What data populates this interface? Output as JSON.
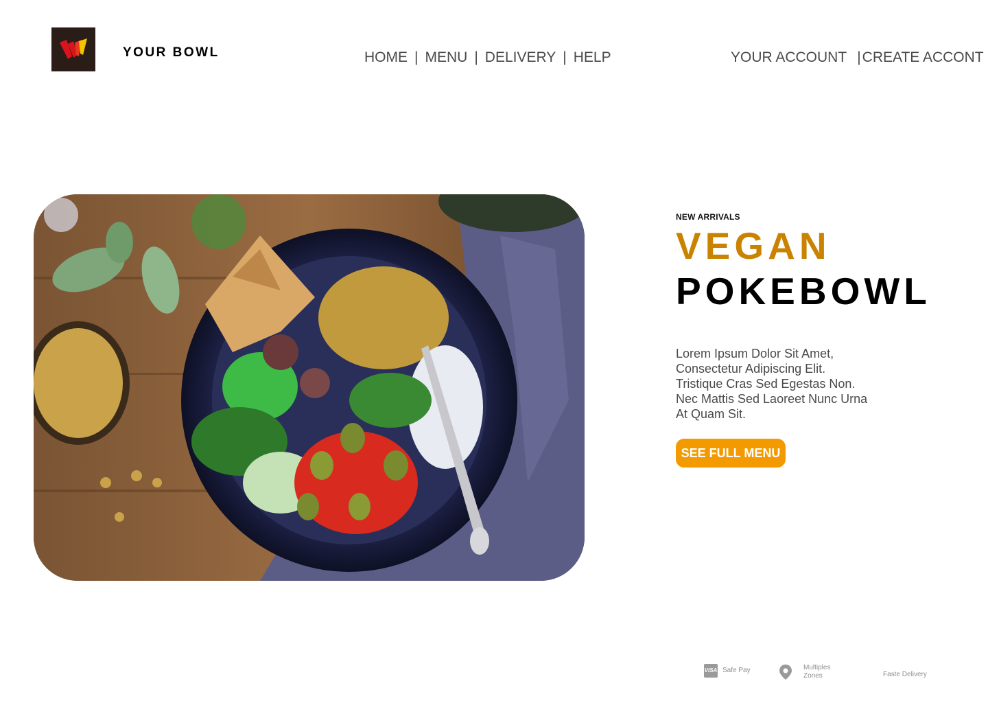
{
  "brand": {
    "name": "YOUR BOWL",
    "logo_icon": "w-logo-icon"
  },
  "nav": {
    "items": [
      {
        "label": "HOME"
      },
      {
        "label": "MENU"
      },
      {
        "label": "DELIVERY"
      },
      {
        "label": "HELP"
      }
    ],
    "separator": "|"
  },
  "account": {
    "your_account": "YOUR ACCOUNT",
    "separator": "|",
    "create_account": "CREATE ACCONT"
  },
  "hero": {
    "eyebrow": "NEW ARRIVALS",
    "title_line1": "VEGAN",
    "title_line2": "POKEBOWL",
    "description_lines": [
      "Lorem Ipsum Dolor Sit Amet,",
      "Consectetur Adipiscing Elit.",
      "Tristique Cras Sed Egestas Non.",
      "Nec Mattis Sed Laoreet Nunc Urna",
      "At Quam Sit."
    ],
    "cta_label": "SEE FULL MENU",
    "image_icon": "vegan-bowl-photo"
  },
  "features": {
    "safe_pay": {
      "icon": "visa-icon",
      "icon_text": "VISA",
      "label": "Safe Pay"
    },
    "zones": {
      "icon": "location-pin-icon",
      "label_line1": "Multiples",
      "label_line2": "Zones"
    },
    "delivery": {
      "label": "Faste Delivery"
    }
  },
  "colors": {
    "accent_gold": "#c98300",
    "cta_orange": "#f39a00",
    "logo_bg": "#2a1c17",
    "logo_red": "#d9141c",
    "logo_yellow": "#f4c400"
  }
}
